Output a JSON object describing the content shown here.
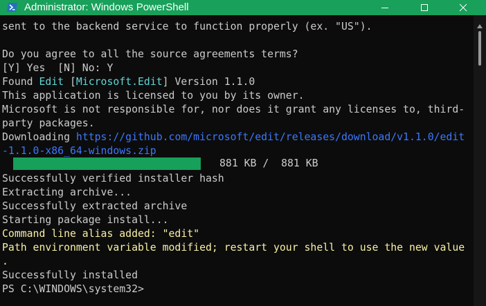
{
  "window": {
    "title": "Administrator: Windows PowerShell",
    "icon": "powershell-icon",
    "controls": [
      "minimize-icon",
      "maximize-icon",
      "close-icon"
    ]
  },
  "colors": {
    "titlebar": "#19a05a",
    "background": "#0c0c0c",
    "text": "#cccccc",
    "yellow": "#f9f1a5",
    "cyan": "#61d6d6",
    "link": "#3b78ff",
    "progress": "#16a05a"
  },
  "terminal": {
    "line01": "sent to the backend service to function properly (ex. \"US\").",
    "line02": "",
    "line03": "Do you agree to all the source agreements terms?",
    "line04": "[Y] Yes  [N] No: Y",
    "line05_prefix": "Found ",
    "line05_name": "Edit",
    "line05_mid1": " [",
    "line05_id": "Microsoft.Edit",
    "line05_mid2": "] Version 1.1.0",
    "line06": "This application is licensed to you by its owner.",
    "line07": "Microsoft is not responsible for, nor does it grant any licenses to, third-",
    "line08": "party packages.",
    "line09_prefix": "Downloading ",
    "line09_url": "https://github.com/microsoft/edit/releases/download/v1.1.0/edit",
    "line10_url": "-1.1.0-x86_64-windows.zip",
    "progress_fraction": 1.0,
    "progress_text": "881 KB /  881 KB",
    "line12": "Successfully verified installer hash",
    "line13": "Extracting archive...",
    "line14": "Successfully extracted archive",
    "line15": "Starting package install...",
    "line16": "Command line alias added: \"edit\"",
    "line17": "Path environment variable modified; restart your shell to use the new value",
    "line18": ".",
    "line19": "Successfully installed",
    "line20": "PS C:\\WINDOWS\\system32>"
  }
}
